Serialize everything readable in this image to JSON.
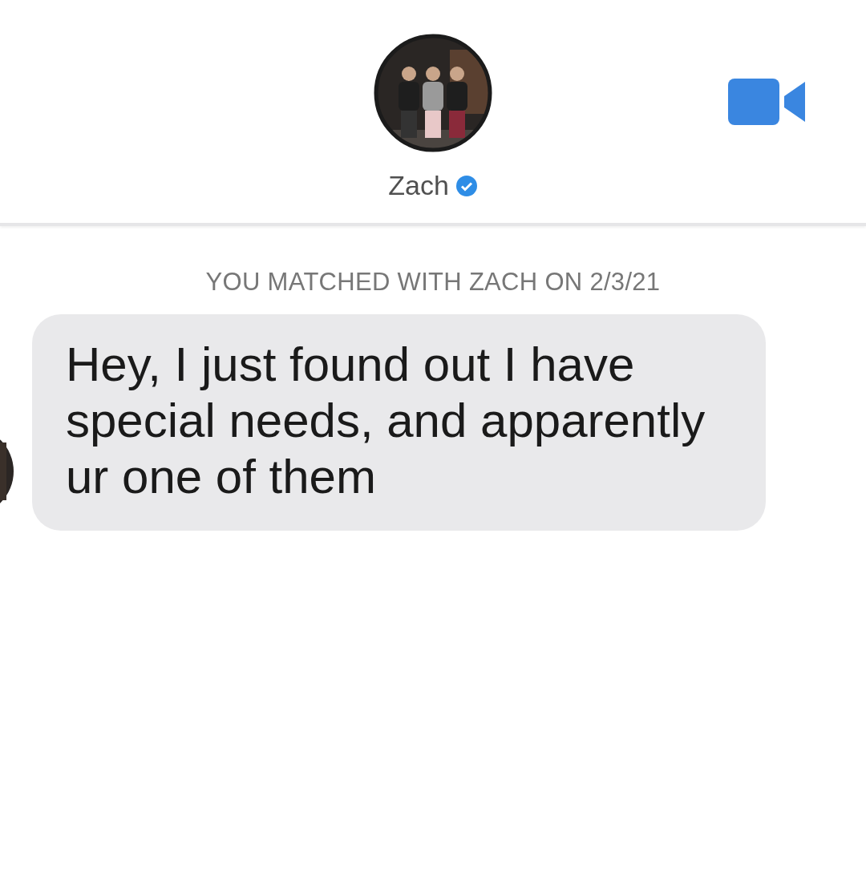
{
  "header": {
    "name": "Zach",
    "verified": true
  },
  "match_notice": "YOU MATCHED WITH ZACH ON 2/3/21",
  "messages": [
    {
      "text": "Hey, I just found out I have special needs, and apparently ur one of them"
    }
  ]
}
